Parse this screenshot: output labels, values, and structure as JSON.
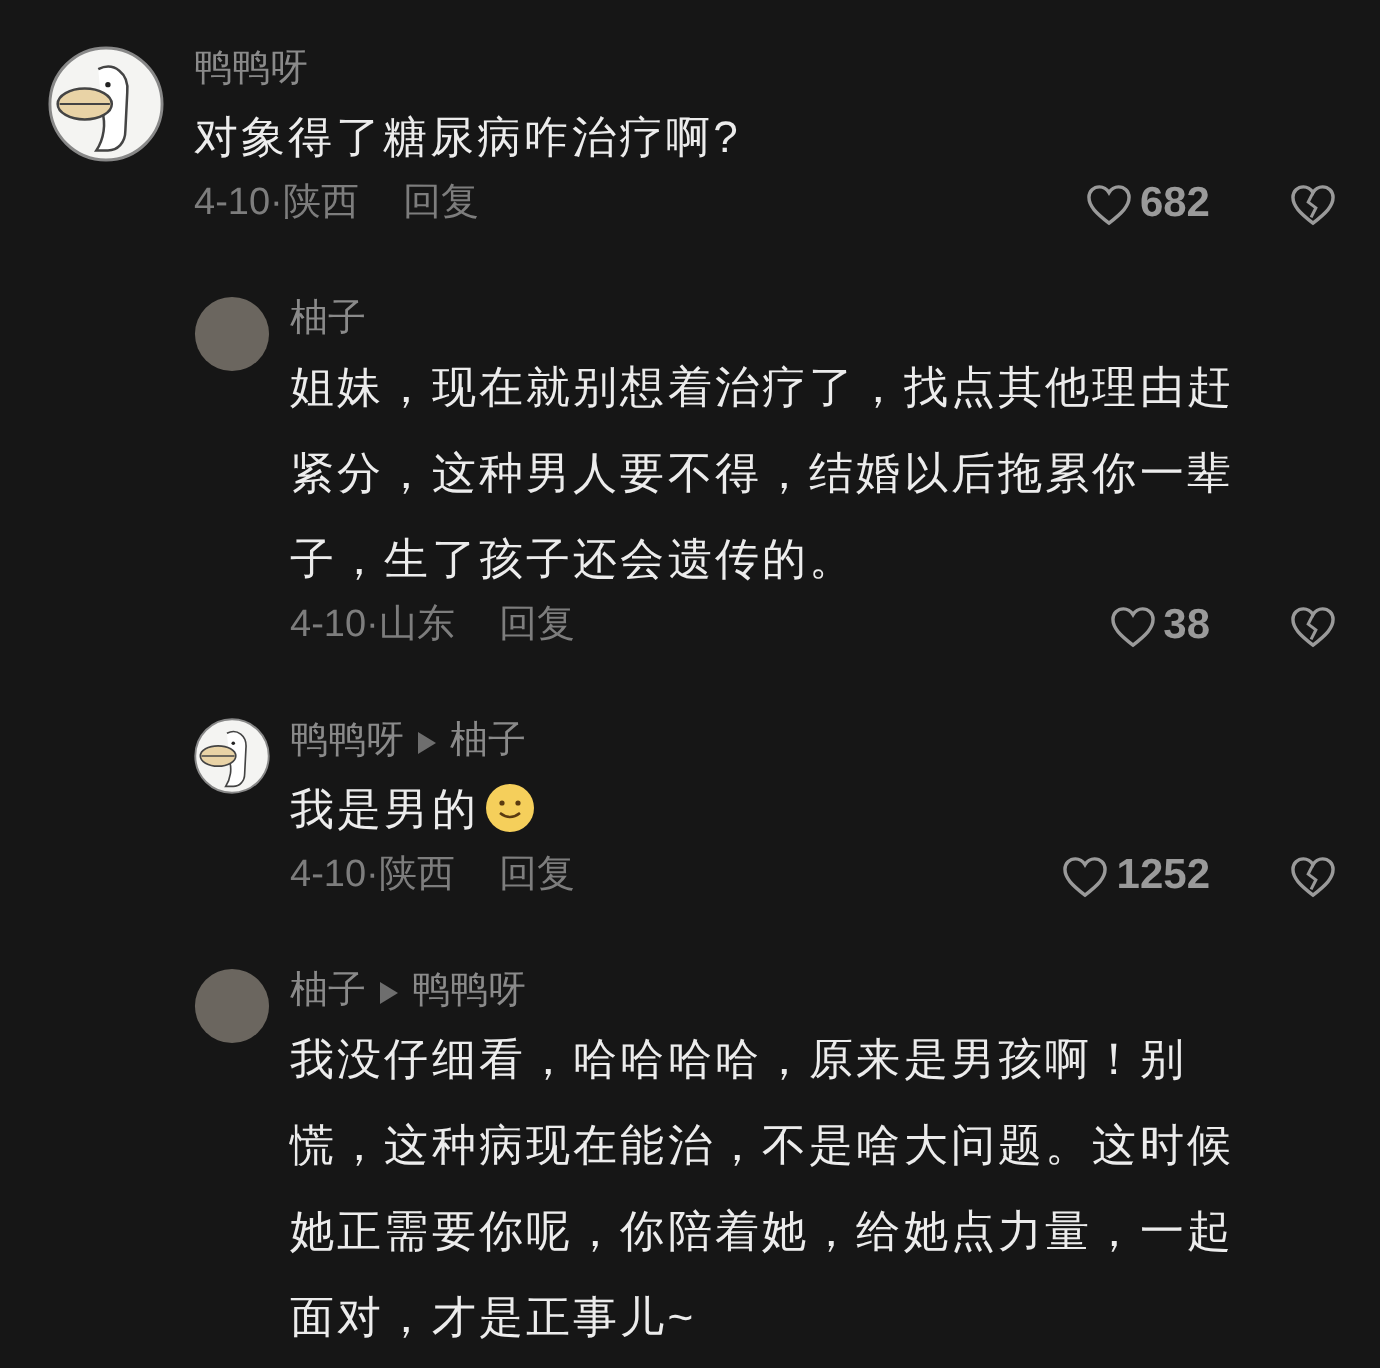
{
  "comments": [
    {
      "avatar": {
        "kind": "duck"
      },
      "name": "鸭鸭呀",
      "text": "对象得了糖尿病咋治疗啊?",
      "meta": "4-10·陕西",
      "reply_label": "回复",
      "likes": "682",
      "children": [
        {
          "avatar": {
            "kind": "photo"
          },
          "name": "柚子",
          "text": "姐妹，现在就别想着治疗了，找点其他理由赶紧分，这种男人要不得，结婚以后拖累你一辈子，生了孩子还会遗传的。",
          "meta": "4-10·山东",
          "reply_label": "回复",
          "likes": "38"
        },
        {
          "avatar": {
            "kind": "duck"
          },
          "name": "鸭鸭呀",
          "reply_to": "柚子",
          "text": "我是男的",
          "emoji": true,
          "meta": "4-10·陕西",
          "reply_label": "回复",
          "likes": "1252"
        },
        {
          "avatar": {
            "kind": "photo"
          },
          "name": "柚子",
          "reply_to": "鸭鸭呀",
          "text": "我没仔细看，哈哈哈哈，原来是男孩啊！别慌，这种病现在能治，不是啥大问题。这时候她正需要你呢，你陪着她，给她点力量，一起面对，才是正事儿~"
        }
      ]
    }
  ]
}
